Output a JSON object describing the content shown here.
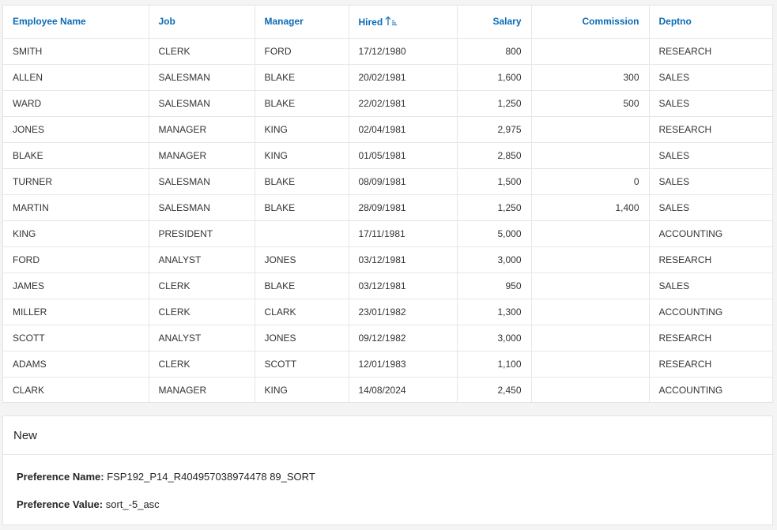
{
  "table": {
    "columns": {
      "ename": "Employee Name",
      "job": "Job",
      "mgr": "Manager",
      "hired": "Hired",
      "sal": "Salary",
      "comm": "Commission",
      "dept": "Deptno"
    },
    "rows": [
      {
        "ename": "SMITH",
        "job": "CLERK",
        "mgr": "FORD",
        "hired": "17/12/1980",
        "sal": "800",
        "comm": "",
        "dept": "RESEARCH"
      },
      {
        "ename": "ALLEN",
        "job": "SALESMAN",
        "mgr": "BLAKE",
        "hired": "20/02/1981",
        "sal": "1,600",
        "comm": "300",
        "dept": "SALES"
      },
      {
        "ename": "WARD",
        "job": "SALESMAN",
        "mgr": "BLAKE",
        "hired": "22/02/1981",
        "sal": "1,250",
        "comm": "500",
        "dept": "SALES"
      },
      {
        "ename": "JONES",
        "job": "MANAGER",
        "mgr": "KING",
        "hired": "02/04/1981",
        "sal": "2,975",
        "comm": "",
        "dept": "RESEARCH"
      },
      {
        "ename": "BLAKE",
        "job": "MANAGER",
        "mgr": "KING",
        "hired": "01/05/1981",
        "sal": "2,850",
        "comm": "",
        "dept": "SALES"
      },
      {
        "ename": "TURNER",
        "job": "SALESMAN",
        "mgr": "BLAKE",
        "hired": "08/09/1981",
        "sal": "1,500",
        "comm": "0",
        "dept": "SALES"
      },
      {
        "ename": "MARTIN",
        "job": "SALESMAN",
        "mgr": "BLAKE",
        "hired": "28/09/1981",
        "sal": "1,250",
        "comm": "1,400",
        "dept": "SALES"
      },
      {
        "ename": "KING",
        "job": "PRESIDENT",
        "mgr": "",
        "hired": "17/11/1981",
        "sal": "5,000",
        "comm": "",
        "dept": "ACCOUNTING"
      },
      {
        "ename": "FORD",
        "job": "ANALYST",
        "mgr": "JONES",
        "hired": "03/12/1981",
        "sal": "3,000",
        "comm": "",
        "dept": "RESEARCH"
      },
      {
        "ename": "JAMES",
        "job": "CLERK",
        "mgr": "BLAKE",
        "hired": "03/12/1981",
        "sal": "950",
        "comm": "",
        "dept": "SALES"
      },
      {
        "ename": "MILLER",
        "job": "CLERK",
        "mgr": "CLARK",
        "hired": "23/01/1982",
        "sal": "1,300",
        "comm": "",
        "dept": "ACCOUNTING"
      },
      {
        "ename": "SCOTT",
        "job": "ANALYST",
        "mgr": "JONES",
        "hired": "09/12/1982",
        "sal": "3,000",
        "comm": "",
        "dept": "RESEARCH"
      },
      {
        "ename": "ADAMS",
        "job": "CLERK",
        "mgr": "SCOTT",
        "hired": "12/01/1983",
        "sal": "1,100",
        "comm": "",
        "dept": "RESEARCH"
      },
      {
        "ename": "CLARK",
        "job": "MANAGER",
        "mgr": "KING",
        "hired": "14/08/2024",
        "sal": "2,450",
        "comm": "",
        "dept": "ACCOUNTING"
      }
    ],
    "sort_icon": "sort-ascending-icon",
    "header_color": "#0a6bb5"
  },
  "panel": {
    "title": "New",
    "pref_name_label": "Preference Name:",
    "pref_name_value": "FSP192_P14_R404957038974478 89_SORT",
    "pref_value_label": "Preference Value:",
    "pref_value_value": "sort_-5_asc"
  }
}
